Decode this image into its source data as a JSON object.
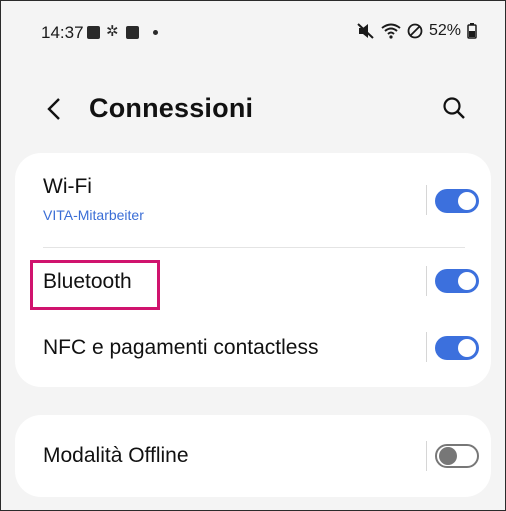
{
  "status_bar": {
    "time": "14:37",
    "battery": "52%",
    "icons": [
      "gallery-icon",
      "settings-gear-icon",
      "checkbox-icon",
      "notification-dot",
      "mute-icon",
      "wifi-icon",
      "do-not-disturb-icon",
      "battery-icon"
    ]
  },
  "header": {
    "title": "Connessioni",
    "back_icon": "back-chevron-icon",
    "search_icon": "search-icon"
  },
  "settings": [
    {
      "title": "Wi-Fi",
      "subtitle": "VITA-Mitarbeiter",
      "enabled": true
    },
    {
      "title": "Bluetooth",
      "enabled": true,
      "highlighted": true
    },
    {
      "title": "NFC e pagamenti contactless",
      "enabled": true
    }
  ],
  "settings2": [
    {
      "title": "Modalità Offline",
      "enabled": false
    }
  ],
  "colors": {
    "accent": "#3c70dd",
    "highlight": "#d0136e",
    "background": "#f4f4f4",
    "card": "#ffffff"
  }
}
